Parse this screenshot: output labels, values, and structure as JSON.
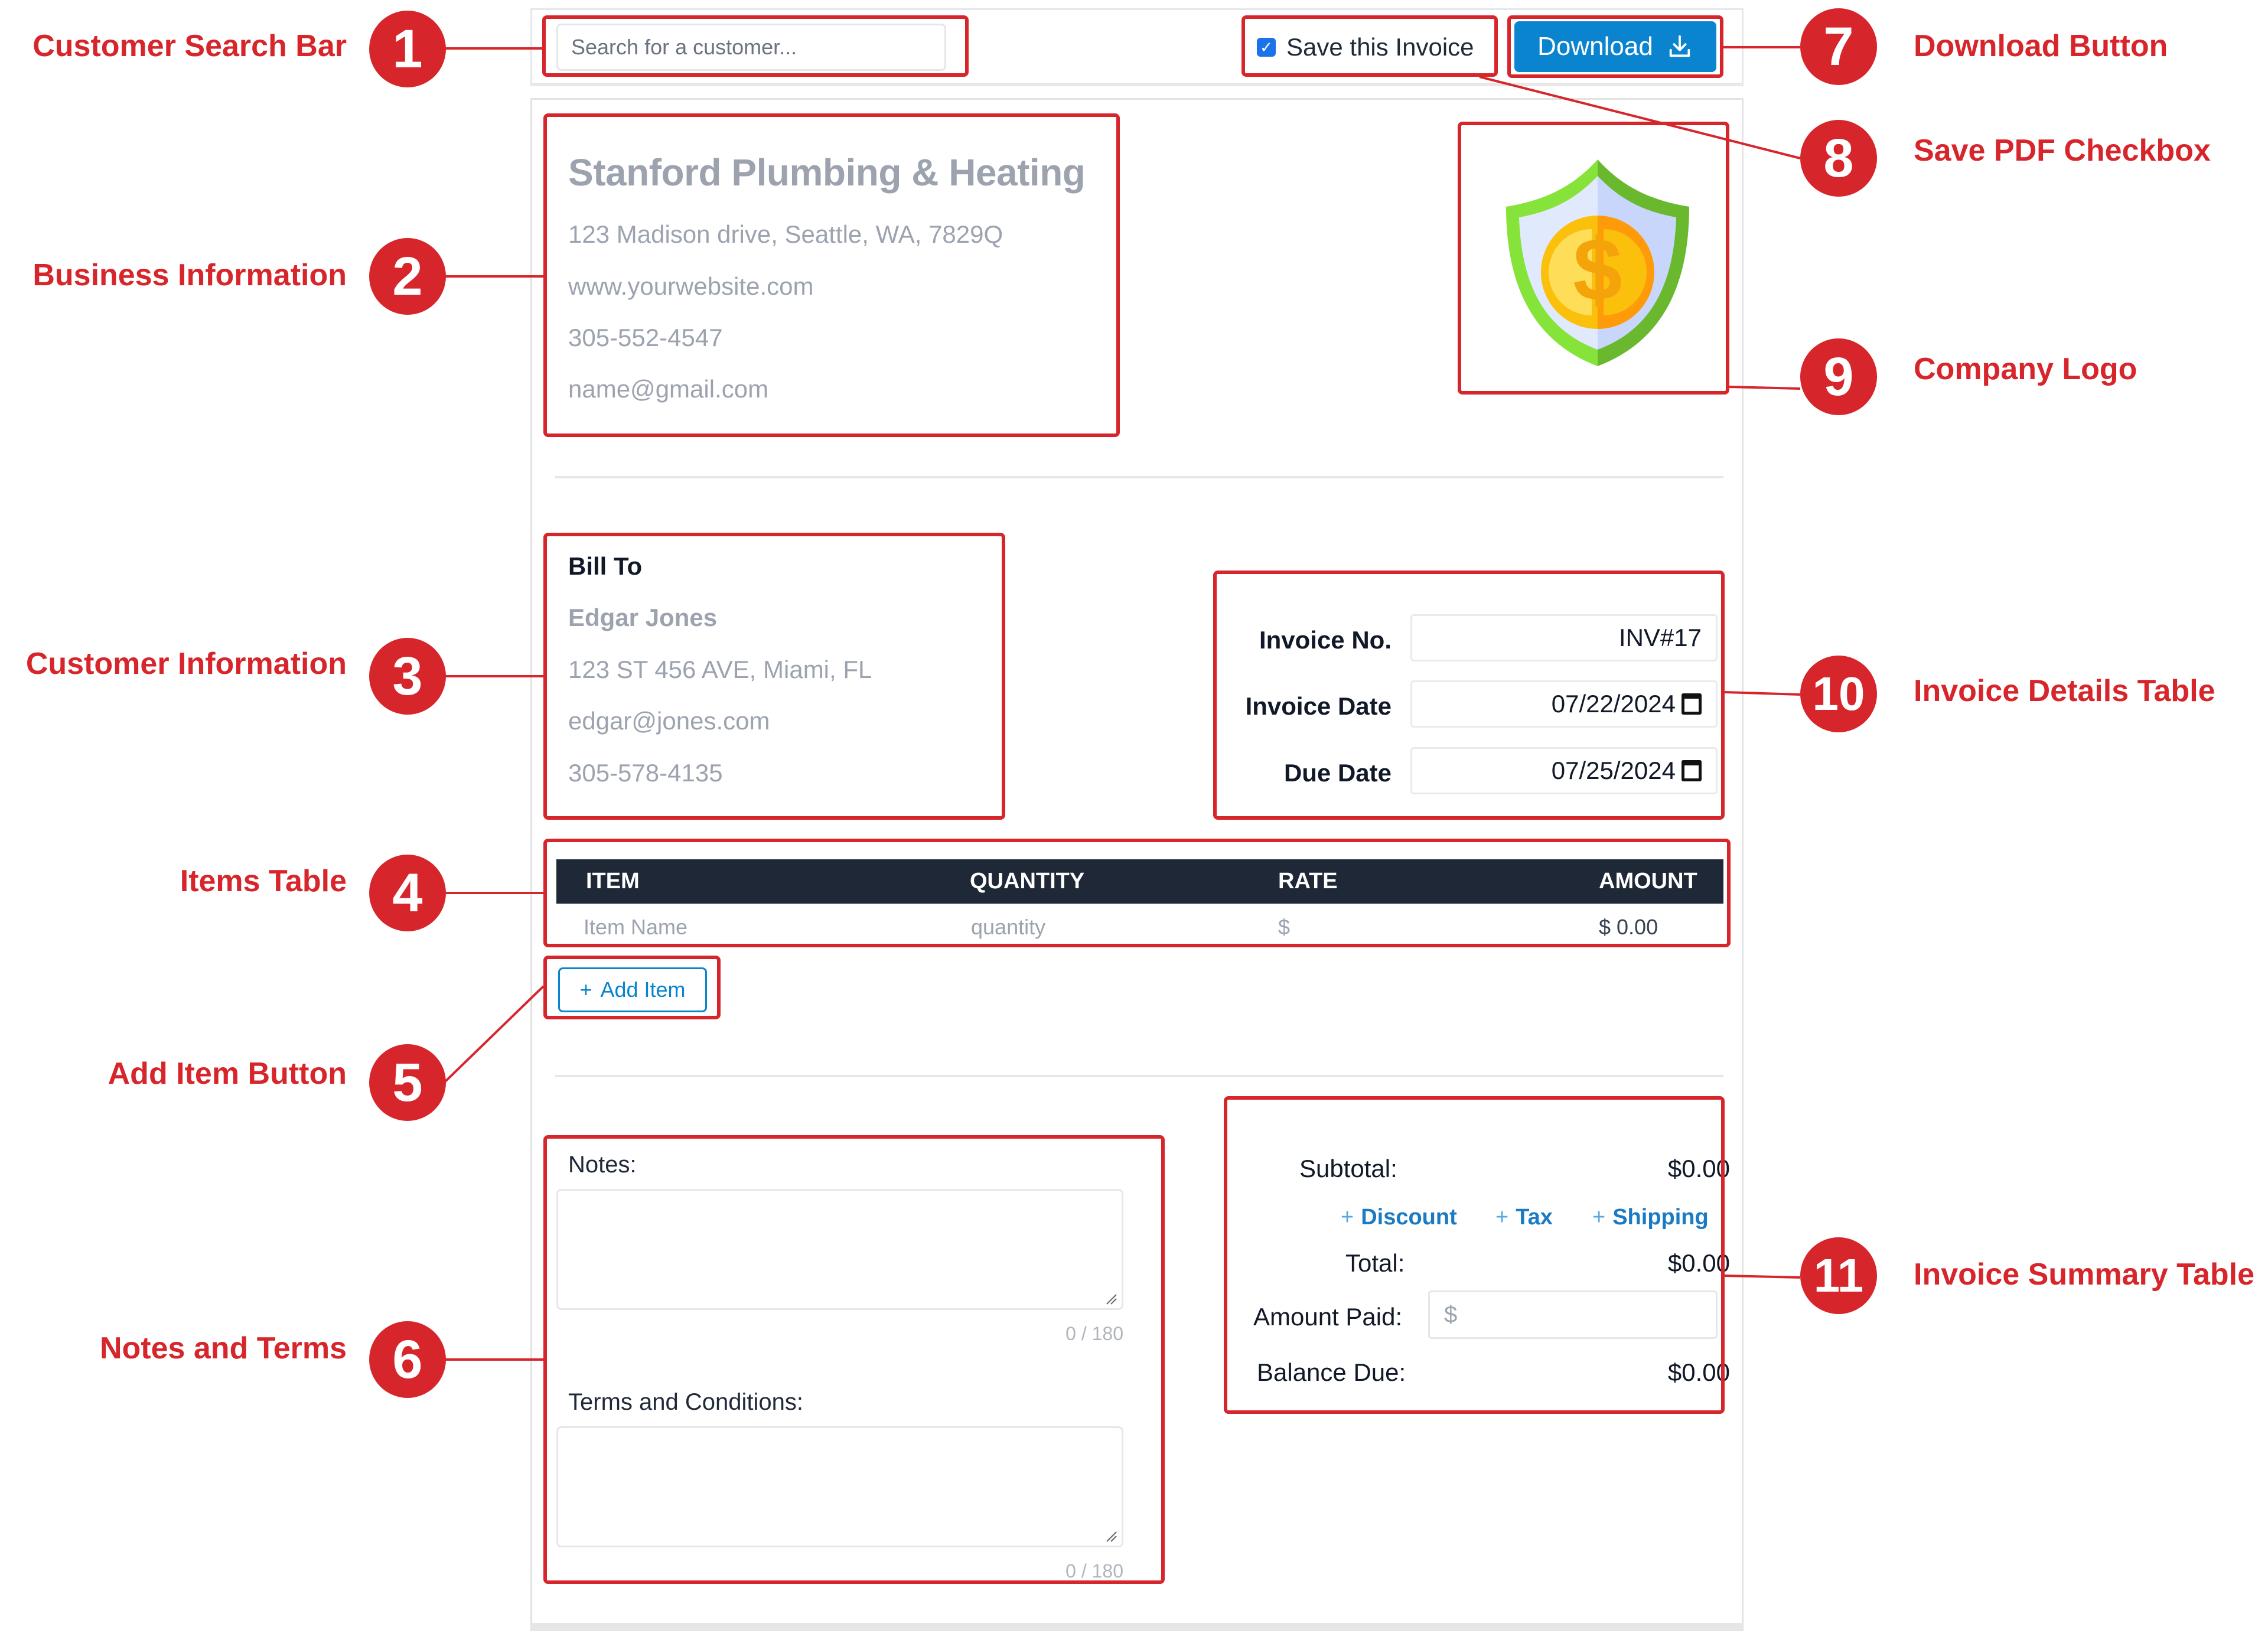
{
  "annotations": [
    {
      "number": "1",
      "label": "Customer Search Bar"
    },
    {
      "number": "2",
      "label": "Business Information"
    },
    {
      "number": "3",
      "label": "Customer Information"
    },
    {
      "number": "4",
      "label": "Items Table"
    },
    {
      "number": "5",
      "label": "Add Item Button"
    },
    {
      "number": "6",
      "label": "Notes and Terms"
    },
    {
      "number": "7",
      "label": "Download Button"
    },
    {
      "number": "8",
      "label": "Save PDF Checkbox"
    },
    {
      "number": "9",
      "label": "Company Logo"
    },
    {
      "number": "10",
      "label": "Invoice Details Table"
    },
    {
      "number": "11",
      "label": "Invoice Summary Table"
    }
  ],
  "toolbar": {
    "search_placeholder": "Search for a customer...",
    "save_invoice_label": "Save this Invoice",
    "save_invoice_checked": true,
    "download_label": "Download",
    "download_icon": "download-icon"
  },
  "business": {
    "name": "Stanford Plumbing & Heating",
    "address": "123 Madison drive, Seattle, WA, 7829Q",
    "website": "www.yourwebsite.com",
    "phone": "305-552-4547",
    "email": "name@gmail.com",
    "logo": "shield-dollar-logo"
  },
  "bill_to": {
    "title": "Bill To",
    "name": "Edgar Jones",
    "address": "123 ST 456 AVE, Miami, FL",
    "email": "edgar@jones.com",
    "phone": "305-578-4135"
  },
  "invoice_details": {
    "number_label": "Invoice No.",
    "number_value": "INV#17",
    "date_label": "Invoice Date",
    "date_value": "07/22/2024",
    "due_label": "Due Date",
    "due_value": "07/25/2024"
  },
  "items_table": {
    "columns": [
      "ITEM",
      "QUANTITY",
      "RATE",
      "AMOUNT"
    ],
    "rows": [
      {
        "item": "Item Name",
        "quantity": "quantity",
        "rate": "$",
        "amount": "$ 0.00"
      }
    ]
  },
  "add_item_label": "Add Item",
  "notes": {
    "notes_label": "Notes:",
    "notes_counter": "0 / 180",
    "terms_label": "Terms and Conditions:",
    "terms_counter": "0 / 180"
  },
  "summary": {
    "subtotal_label": "Subtotal:",
    "subtotal_value": "$0.00",
    "discount_link": "Discount",
    "tax_link": "Tax",
    "shipping_link": "Shipping",
    "total_label": "Total:",
    "total_value": "$0.00",
    "amount_paid_label": "Amount Paid:",
    "amount_paid_placeholder": "$",
    "balance_label": "Balance Due:",
    "balance_value": "$0.00"
  },
  "colors": {
    "annotation_red": "#d7262b",
    "primary_blue": "#0a84cf",
    "table_header": "#1e2836",
    "muted_text": "#9ca3af"
  }
}
